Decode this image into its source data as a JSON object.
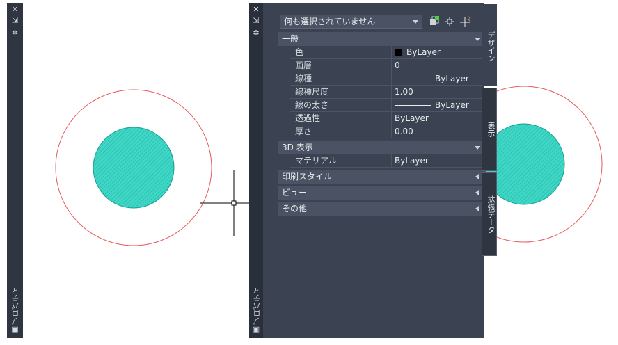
{
  "left_palette": {
    "title": "プロパティ",
    "buttons": [
      "close-icon",
      "pin-icon",
      "settings-icon"
    ]
  },
  "palette": {
    "title": "プロパティ",
    "selection_dropdown": {
      "value": "何も選択されていません"
    },
    "tabs": [
      "デザイン",
      "表示",
      "拡張データ"
    ],
    "sections": [
      {
        "label": "一般",
        "expanded": true,
        "rows": [
          {
            "name": "色",
            "value": "ByLayer",
            "swatch": "#000000"
          },
          {
            "name": "画層",
            "value": "0"
          },
          {
            "name": "線種",
            "value": "ByLayer",
            "line": true
          },
          {
            "name": "線種尺度",
            "value": "1.00"
          },
          {
            "name": "線の太さ",
            "value": "ByLayer",
            "line": true
          },
          {
            "name": "透過性",
            "value": "ByLayer"
          },
          {
            "name": "厚さ",
            "value": "0.00"
          }
        ]
      },
      {
        "label": "3D 表示",
        "expanded": true,
        "rows": [
          {
            "name": "マテリアル",
            "value": "ByLayer"
          }
        ]
      },
      {
        "label": "印刷スタイル",
        "expanded": false
      },
      {
        "label": "ビュー",
        "expanded": false
      },
      {
        "label": "その他",
        "expanded": false
      }
    ]
  },
  "colors": {
    "palette_bg": "#3b4352",
    "circle_outline": "#e85a5a",
    "hatch_fill": "#3fd6c6"
  }
}
